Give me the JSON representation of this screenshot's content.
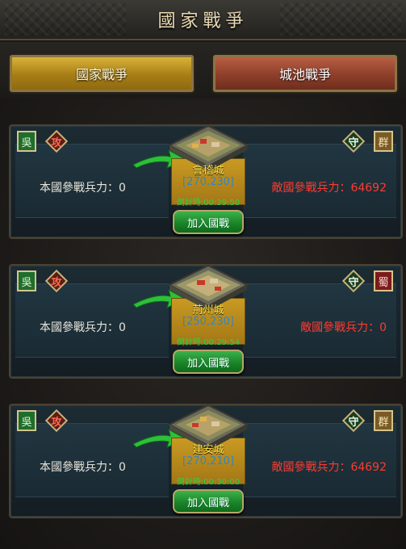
{
  "header": {
    "title": "國家戰爭"
  },
  "tabs": [
    {
      "label": "國家戰爭",
      "active": true
    },
    {
      "label": "城池戰爭",
      "active": false
    }
  ],
  "battles": [
    {
      "attacker_faction": "吳",
      "attack_label": "攻",
      "defend_label": "守",
      "defender_faction": "群",
      "defender_color": "#7a5a26",
      "city_name": "會稽城",
      "coords": "[270,230]",
      "countdown": "倒計時:00:29:50",
      "own_force": "本國參戰兵力：0",
      "enemy_force": "敵國參戰兵力：64692",
      "join_label": "加入國戰"
    },
    {
      "attacker_faction": "吳",
      "attack_label": "攻",
      "defend_label": "守",
      "defender_faction": "蜀",
      "defender_color": "#7d1b1b",
      "city_name": "荊州城",
      "coords": "[250,230]",
      "countdown": "倒計時:00:29:54",
      "own_force": "本國參戰兵力：0",
      "enemy_force": "敵國參戰兵力：0",
      "join_label": "加入國戰"
    },
    {
      "attacker_faction": "吳",
      "attack_label": "攻",
      "defend_label": "守",
      "defender_faction": "群",
      "defender_color": "#7a5a26",
      "city_name": "建安城",
      "coords": "[270,210]",
      "countdown": "倒計時:00:30:00",
      "own_force": "本國參戰兵力：0",
      "enemy_force": "敵國參戰兵力：64692",
      "join_label": "加入國戰"
    }
  ],
  "icons": {
    "city": "city-fortress-icon",
    "arrow": "green-arrow-icon",
    "attacker_flag": "faction-flag-icon",
    "defender_flag": "faction-flag-icon"
  }
}
